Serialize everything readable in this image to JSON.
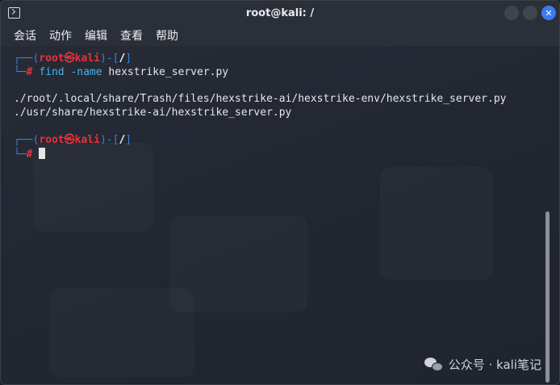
{
  "window": {
    "title": "root@kali: /"
  },
  "window_controls": {
    "minimize": "",
    "maximize": "",
    "close": "✕"
  },
  "menu": {
    "items": [
      "会话",
      "动作",
      "编辑",
      "查看",
      "帮助"
    ]
  },
  "terminal": {
    "prompt1": {
      "corner_top": "┌──(",
      "user": "root",
      "at": "㉿",
      "host": "kali",
      "close_paren": ")-[",
      "path": "/",
      "close_bracket": "]",
      "corner_bottom": "└─",
      "hash": "#",
      "command": "find",
      "option": "-name",
      "argument": "hexstrike_server.py"
    },
    "output": [
      "./root/.local/share/Trash/files/hexstrike-ai/hexstrike-env/hexstrike_server.py",
      "./usr/share/hexstrike-ai/hexstrike_server.py"
    ],
    "prompt2": {
      "corner_top": "┌──(",
      "user": "root",
      "at": "㉿",
      "host": "kali",
      "close_paren": ")-[",
      "path": "/",
      "close_bracket": "]",
      "corner_bottom": "└─",
      "hash": "#"
    }
  },
  "watermark": {
    "text": "公众号 · kali笔记"
  },
  "colors": {
    "prompt_frame": "#3f7fd8",
    "prompt_user": "#e8333a",
    "command": "#49b0e8",
    "close_button": "#3a7bf2"
  }
}
